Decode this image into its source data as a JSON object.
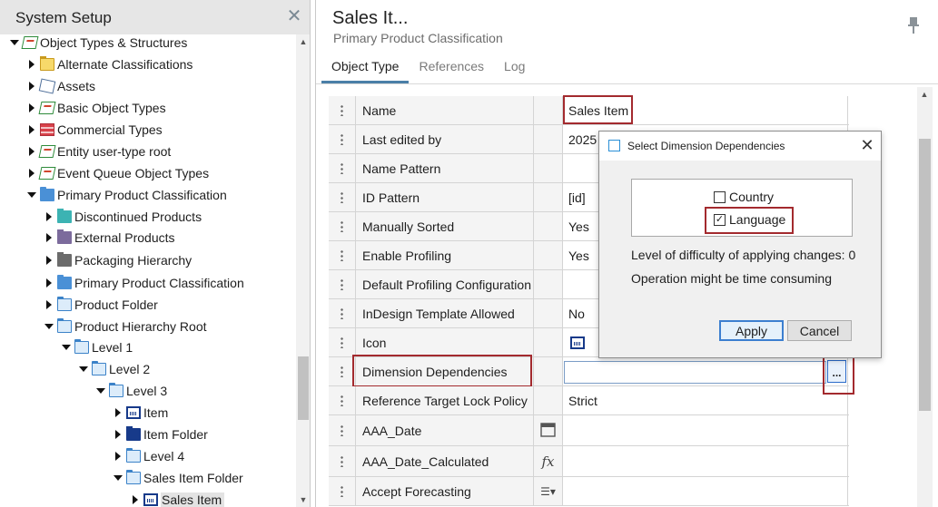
{
  "left_panel": {
    "title": "System Setup",
    "close_glyph": "✕",
    "tree": [
      {
        "label": "Object Types & Structures",
        "expanded": true,
        "icon": "tag-icon"
      },
      {
        "label": "Alternate Classifications",
        "expanded": false,
        "icon": "folder-yellow-icon"
      },
      {
        "label": "Assets",
        "expanded": false,
        "icon": "asset-icon"
      },
      {
        "label": "Basic Object Types",
        "expanded": false,
        "icon": "tag-icon"
      },
      {
        "label": "Commercial Types",
        "expanded": false,
        "icon": "table-icon"
      },
      {
        "label": "Entity user-type root",
        "expanded": false,
        "icon": "tag-icon"
      },
      {
        "label": "Event Queue Object Types",
        "expanded": false,
        "icon": "tag-icon"
      },
      {
        "label": "Primary Product Classification",
        "expanded": true,
        "icon": "folder-blue-icon"
      },
      {
        "label": "Discontinued Products",
        "expanded": false,
        "icon": "folder-teal-icon"
      },
      {
        "label": "External Products",
        "expanded": false,
        "icon": "folder-purple-icon"
      },
      {
        "label": "Packaging Hierarchy",
        "expanded": false,
        "icon": "folder-gray-icon"
      },
      {
        "label": "Primary Product Classification",
        "expanded": false,
        "icon": "folder-blue-icon"
      },
      {
        "label": "Product Folder",
        "expanded": false,
        "icon": "folder-outline-icon"
      },
      {
        "label": "Product Hierarchy Root",
        "expanded": true,
        "icon": "folder-outline-icon"
      },
      {
        "label": "Level 1",
        "expanded": true,
        "icon": "folder-outline-icon"
      },
      {
        "label": "Level 2",
        "expanded": true,
        "icon": "folder-outline-icon"
      },
      {
        "label": "Level 3",
        "expanded": true,
        "icon": "folder-outline-icon"
      },
      {
        "label": "Item",
        "expanded": false,
        "icon": "item-icon"
      },
      {
        "label": "Item Folder",
        "expanded": false,
        "icon": "folder-navy-icon"
      },
      {
        "label": "Level 4",
        "expanded": false,
        "icon": "folder-outline-icon"
      },
      {
        "label": "Sales Item Folder",
        "expanded": true,
        "icon": "folder-outline-icon"
      },
      {
        "label": "Sales Item",
        "expanded": false,
        "icon": "item-icon",
        "selected": true
      }
    ]
  },
  "header": {
    "title": "Sales It...",
    "subtitle": "Primary Product Classification"
  },
  "tabs": [
    {
      "label": "Object Type",
      "active": true
    },
    {
      "label": "References",
      "active": false
    },
    {
      "label": "Log",
      "active": false
    }
  ],
  "grid_rows": [
    {
      "label": "Name",
      "value": "Sales Item",
      "highlight_value": true
    },
    {
      "label": "Last edited by",
      "value": "2025"
    },
    {
      "label": "Name Pattern",
      "value": ""
    },
    {
      "label": "ID Pattern",
      "value": "[id]"
    },
    {
      "label": "Manually Sorted",
      "value": "Yes"
    },
    {
      "label": "Enable Profiling",
      "value": "Yes"
    },
    {
      "label": "Default Profiling Configuration",
      "value": ""
    },
    {
      "label": "InDesign Template Allowed",
      "value": "No"
    },
    {
      "label": "Icon",
      "value": "",
      "value_icon": "item-icon"
    },
    {
      "label": "Dimension Dependencies",
      "value": "",
      "highlight_label": true
    },
    {
      "label": "Reference Target Lock Policy",
      "value": "Strict"
    },
    {
      "label": "AAA_Date",
      "value": "",
      "type_icon": "calendar-icon"
    },
    {
      "label": "AAA_Date_Calculated",
      "value": "",
      "type_icon": "fx-icon",
      "type_glyph": "fx"
    },
    {
      "label": "Accept Forecasting",
      "value": "",
      "type_icon": "list-icon",
      "type_glyph": "☰▾"
    }
  ],
  "dots_button": {
    "label": "..."
  },
  "dialog": {
    "title": "Select Dimension Dependencies",
    "close_glyph": "✕",
    "options": [
      {
        "label": "Country",
        "checked": false
      },
      {
        "label": "Language",
        "checked": true
      }
    ],
    "check_glyph": "✓",
    "difficulty_text": "Level of difficulty of applying changes: 0",
    "warning_text": "Operation might be time consuming",
    "apply_label": "Apply",
    "cancel_label": "Cancel"
  },
  "colors": {
    "highlight": "#a32a2e",
    "tab_underline": "#4a7fa7",
    "dialog_default_button": "#3c7fd0"
  }
}
